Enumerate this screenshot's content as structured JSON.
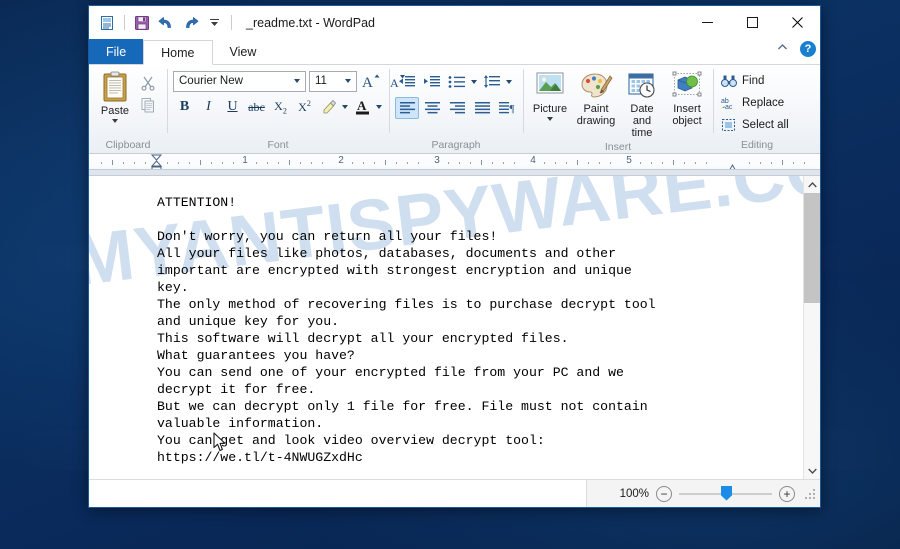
{
  "desktop": {
    "background_color": "#0b3162"
  },
  "window": {
    "title": "_readme.txt - WordPad",
    "quick_access": [
      {
        "name": "wordpad-doc-icon",
        "label": "WordPad"
      },
      {
        "name": "save-icon",
        "label": "Save"
      },
      {
        "name": "undo-icon",
        "label": "Undo"
      },
      {
        "name": "redo-icon",
        "label": "Redo"
      },
      {
        "name": "customize-qat-icon",
        "label": "Customize Quick Access Toolbar"
      }
    ],
    "controls": {
      "minimize": "—",
      "maximize": "□",
      "close": "✕"
    }
  },
  "tabs": [
    {
      "label": "File",
      "active": false,
      "kind": "file"
    },
    {
      "label": "Home",
      "active": true,
      "kind": "normal"
    },
    {
      "label": "View",
      "active": false,
      "kind": "normal"
    }
  ],
  "tab_right": {
    "collapse_label": "⌃",
    "help_label": "?"
  },
  "ribbon": {
    "groups": [
      {
        "name": "clipboard",
        "label": "Clipboard",
        "paste_label": "Paste",
        "cut_label": "Cut",
        "copy_label": "Copy"
      },
      {
        "name": "font",
        "label": "Font",
        "font_family": "Courier New",
        "font_size": "11",
        "grow_label": "A",
        "shrink_label": "A",
        "bold_label": "B",
        "italic_label": "I",
        "underline_label": "U",
        "strike_label": "abc",
        "subscript_label": "X₂",
        "superscript_label": "X²",
        "highlight_label": "Text highlight color",
        "fontcolor_label": "A"
      },
      {
        "name": "paragraph",
        "label": "Paragraph",
        "decrease_indent": "Decrease indent",
        "increase_indent": "Increase indent",
        "bullets": "Start a list",
        "line_spacing": "Line spacing",
        "align_left": "Align left",
        "align_center": "Center",
        "align_right": "Align right",
        "justify": "Justify",
        "paragraph_dialog": "Paragraph settings"
      },
      {
        "name": "insert",
        "label": "Insert",
        "items": [
          {
            "name": "picture",
            "line1": "Picture",
            "line2": ""
          },
          {
            "name": "paint-drawing",
            "line1": "Paint",
            "line2": "drawing"
          },
          {
            "name": "date-and-time",
            "line1": "Date and",
            "line2": "time"
          },
          {
            "name": "insert-object",
            "line1": "Insert",
            "line2": "object"
          }
        ]
      },
      {
        "name": "editing",
        "label": "Editing",
        "items": [
          {
            "name": "find",
            "label": "Find"
          },
          {
            "name": "replace",
            "label": "Replace"
          },
          {
            "name": "select-all",
            "label": "Select all"
          }
        ]
      }
    ]
  },
  "ruler": {
    "numbers": [
      "1",
      "2",
      "3",
      "4",
      "5"
    ]
  },
  "document": {
    "watermark": "MYANTISPYWARE.COM",
    "body": "ATTENTION!\n\nDon't worry, you can return all your files!\nAll your files like photos, databases, documents and other\nimportant are encrypted with strongest encryption and unique\nkey.\nThe only method of recovering files is to purchase decrypt tool\nand unique key for you.\nThis software will decrypt all your encrypted files.\nWhat guarantees you have?\nYou can send one of your encrypted file from your PC and we\ndecrypt it for free.\nBut we can decrypt only 1 file for free. File must not contain\nvaluable information.\nYou can get and look video overview decrypt tool:\nhttps://we.tl/t-4NWUGZxdHc"
  },
  "statusbar": {
    "zoom_value": "100%",
    "zoom_out_label": "−",
    "zoom_in_label": "+"
  }
}
